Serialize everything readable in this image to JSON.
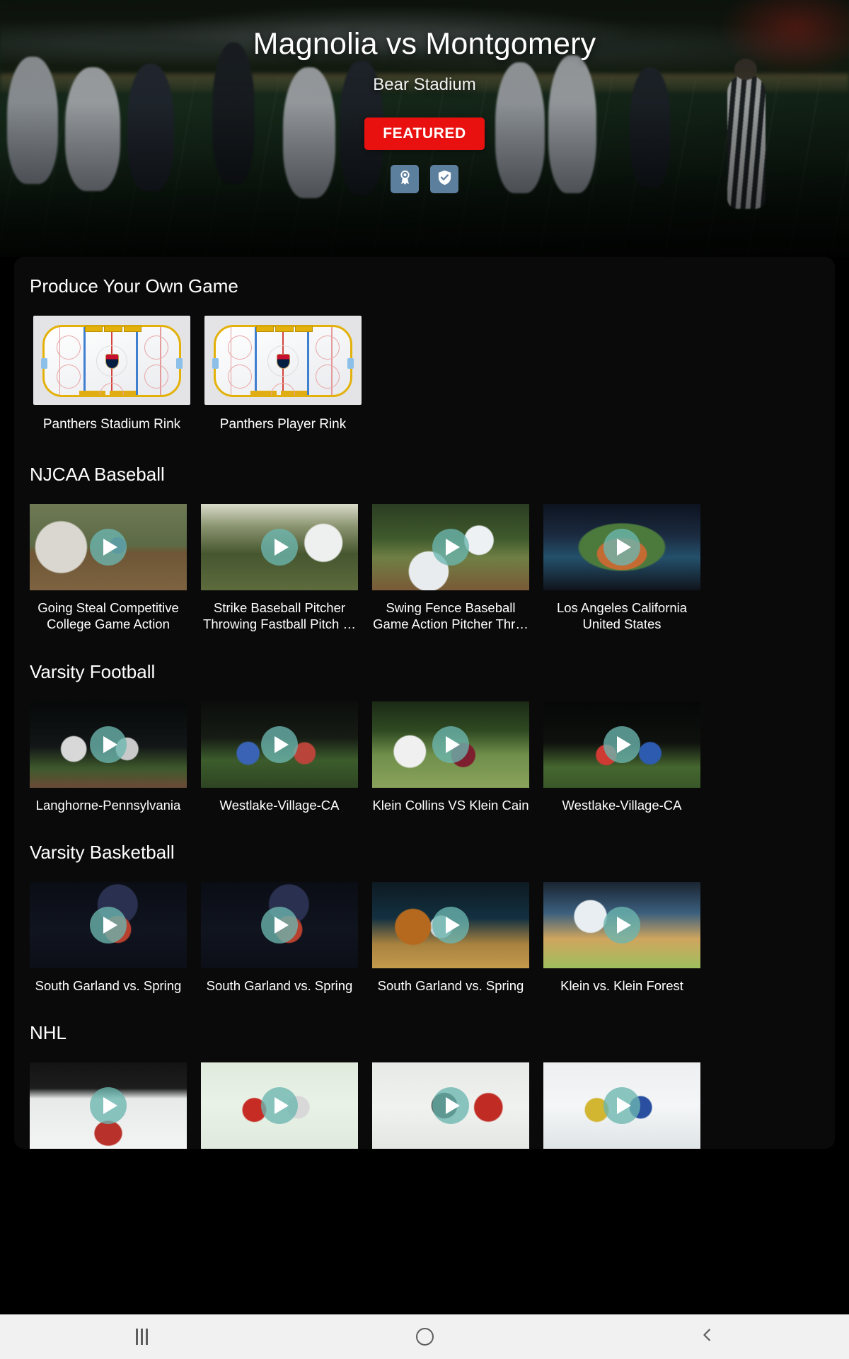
{
  "hero": {
    "title": "Magnolia vs Montgomery",
    "venue": "Bear Stadium",
    "featured_label": "FEATURED",
    "featured_color": "#e8110f",
    "badges": [
      {
        "name": "award-ribbon-icon",
        "label": "Award"
      },
      {
        "name": "shield-check-icon",
        "label": "Verified"
      }
    ],
    "badge_chip_color": "#5d7f9e"
  },
  "sections": [
    {
      "id": "produce-your-own-game",
      "title": "Produce Your Own Game",
      "type": "rink",
      "items": [
        {
          "label": "Panthers Stadium Rink"
        },
        {
          "label": "Panthers Player Rink"
        }
      ]
    },
    {
      "id": "njcaa-baseball",
      "title": "NJCAA Baseball",
      "type": "video",
      "items": [
        {
          "label": "Going Steal Competitive College Game Action",
          "thumb": "t-bb1"
        },
        {
          "label": "Strike Baseball Pitcher Throwing Fastball Pitch …",
          "thumb": "t-bb2"
        },
        {
          "label": "Swing Fence Baseball Game Action Pitcher Thr…",
          "thumb": "t-bb3"
        },
        {
          "label": "Los Angeles California United States",
          "thumb": "t-bb4"
        }
      ]
    },
    {
      "id": "varsity-football",
      "title": "Varsity Football",
      "type": "video",
      "items": [
        {
          "label": "Langhorne-Pennsylvania",
          "thumb": "t-fb1"
        },
        {
          "label": "Westlake-Village-CA",
          "thumb": "t-fb2"
        },
        {
          "label": "Klein Collins VS Klein Cain",
          "thumb": "t-fb3"
        },
        {
          "label": "Westlake-Village-CA",
          "thumb": "t-fb4"
        }
      ]
    },
    {
      "id": "varsity-basketball",
      "title": "Varsity Basketball",
      "type": "video",
      "items": [
        {
          "label": "South Garland vs. Spring",
          "thumb": "t-bk1"
        },
        {
          "label": "South Garland vs. Spring",
          "thumb": "t-bk2"
        },
        {
          "label": "South Garland vs. Spring",
          "thumb": "t-bk3"
        },
        {
          "label": "Klein vs. Klein Forest",
          "thumb": "t-bk4"
        }
      ]
    },
    {
      "id": "nhl",
      "title": "NHL",
      "type": "video",
      "items": [
        {
          "label": "",
          "thumb": "t-nh1"
        },
        {
          "label": "",
          "thumb": "t-nh2"
        },
        {
          "label": "",
          "thumb": "t-nh3"
        },
        {
          "label": "",
          "thumb": "t-nh4"
        }
      ]
    }
  ],
  "play_button": {
    "name": "play-icon",
    "color": "#6cb6b0"
  },
  "navbar": {
    "recents": "recent-apps",
    "home": "home",
    "back": "back"
  }
}
